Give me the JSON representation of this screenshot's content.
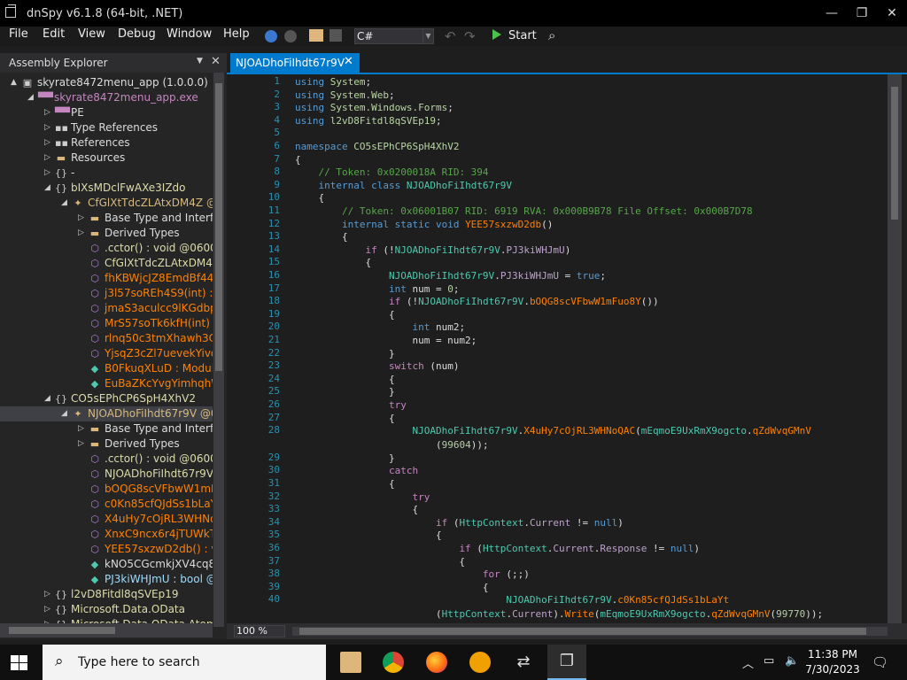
{
  "window": {
    "title": "dnSpy v6.1.8 (64-bit, .NET)"
  },
  "menu": [
    "File",
    "Edit",
    "View",
    "Debug",
    "Window",
    "Help"
  ],
  "toolbar": {
    "language": "C#",
    "start_label": "Start"
  },
  "assembly_explorer": {
    "title": "Assembly Explorer",
    "rows": [
      {
        "label": "skyrate8472menu_app (1.0.0.0)",
        "indent": 0,
        "toggle": "▲",
        "icon": "assembly-icon",
        "glyph": "▣",
        "color": "#dcdcdc",
        "icolor": "#ccc"
      },
      {
        "label": "skyrate8472menu_app.exe",
        "indent": 1,
        "toggle": "◢",
        "icon": "module-icon",
        "glyph": "▀▀",
        "color": "#c586c0",
        "icolor": "#c586c0"
      },
      {
        "label": "PE",
        "indent": 2,
        "toggle": "▷",
        "icon": "pe-icon",
        "glyph": "▀▀",
        "color": "#dcdcdc",
        "icolor": "#c586c0"
      },
      {
        "label": "Type References",
        "indent": 2,
        "toggle": "▷",
        "icon": "type-references-icon",
        "glyph": "▪▪",
        "color": "#dcdcdc",
        "icolor": "#ccc"
      },
      {
        "label": "References",
        "indent": 2,
        "toggle": "▷",
        "icon": "references-icon",
        "glyph": "▪▪",
        "color": "#dcdcdc",
        "icolor": "#ccc"
      },
      {
        "label": "Resources",
        "indent": 2,
        "toggle": "▷",
        "icon": "folder-icon",
        "glyph": "▬",
        "color": "#dcdcdc",
        "icolor": "#dcb67a"
      },
      {
        "label": "-",
        "indent": 2,
        "toggle": "▷",
        "icon": "namespace-icon",
        "glyph": "{}",
        "color": "#dcdcdc",
        "icolor": "#ccc"
      },
      {
        "label": "bIXsMDclFwAXe3IZdo",
        "indent": 2,
        "toggle": "◢",
        "icon": "namespace-icon",
        "glyph": "{}",
        "color": "#dcdcaa",
        "icolor": "#ccc"
      },
      {
        "label": "CfGlXtTdcZLAtxDM4Z @0",
        "indent": 3,
        "toggle": "◢",
        "icon": "class-icon",
        "glyph": "✦",
        "color": "#d7ba7d",
        "icolor": "#dcb67a"
      },
      {
        "label": "Base Type and Interfac",
        "indent": 4,
        "toggle": "▷",
        "icon": "folder-icon",
        "glyph": "▬",
        "color": "#dcdcdc",
        "icolor": "#dcb67a"
      },
      {
        "label": "Derived Types",
        "indent": 4,
        "toggle": "▷",
        "icon": "folder-icon",
        "glyph": "▬",
        "color": "#dcdcdc",
        "icolor": "#dcb67a"
      },
      {
        "label": ".cctor() : void @06001",
        "indent": 4,
        "toggle": "",
        "icon": "method-icon",
        "glyph": "⬡",
        "color": "#dcdcaa",
        "icolor": "#b180d7"
      },
      {
        "label": "CfGlXtTdcZLAtxDM4Z",
        "indent": 4,
        "toggle": "",
        "icon": "method-icon",
        "glyph": "⬡",
        "color": "#dcdcaa",
        "icolor": "#b180d7"
      },
      {
        "label": "fhKBWjcJZ8EmdBf44S",
        "indent": 4,
        "toggle": "",
        "icon": "method-icon",
        "glyph": "⬡",
        "color": "#ff8000",
        "icolor": "#b180d7"
      },
      {
        "label": "j3l57soREh4S9(int) : Ru",
        "indent": 4,
        "toggle": "",
        "icon": "method-icon",
        "glyph": "⬡",
        "color": "#ff8000",
        "icolor": "#b180d7"
      },
      {
        "label": "jmaS3aculcc9lKGdbpt",
        "indent": 4,
        "toggle": "",
        "icon": "method-icon",
        "glyph": "⬡",
        "color": "#ff8000",
        "icolor": "#b180d7"
      },
      {
        "label": "MrS57soTk6kfH(int) : I",
        "indent": 4,
        "toggle": "",
        "icon": "method-icon",
        "glyph": "⬡",
        "color": "#ff8000",
        "icolor": "#b180d7"
      },
      {
        "label": "rlnq50c3tmXhawh3Ch",
        "indent": 4,
        "toggle": "",
        "icon": "method-icon",
        "glyph": "⬡",
        "color": "#ff8000",
        "icolor": "#b180d7"
      },
      {
        "label": "YjsqZ3cZl7uevekYivo(",
        "indent": 4,
        "toggle": "",
        "icon": "method-icon",
        "glyph": "⬡",
        "color": "#ff8000",
        "icolor": "#b180d7"
      },
      {
        "label": "B0FkuqXLuD : Module",
        "indent": 4,
        "toggle": "",
        "icon": "field-icon",
        "glyph": "◆",
        "color": "#ff8000",
        "icolor": "#4ec9b0"
      },
      {
        "label": "EuBaZKcYvgYimhqhW",
        "indent": 4,
        "toggle": "",
        "icon": "field-icon",
        "glyph": "◆",
        "color": "#ff8000",
        "icolor": "#4ec9b0"
      },
      {
        "label": "CO5sEPhCP6SpH4XhV2",
        "indent": 2,
        "toggle": "◢",
        "icon": "namespace-icon",
        "glyph": "{}",
        "color": "#dcdcaa",
        "icolor": "#ccc"
      },
      {
        "label": "NJOADhoFiIhdt67r9V @02",
        "indent": 3,
        "toggle": "◢",
        "icon": "class-icon",
        "glyph": "✦",
        "color": "#d7ba7d",
        "icolor": "#dcb67a",
        "selected": true
      },
      {
        "label": "Base Type and Interfac",
        "indent": 4,
        "toggle": "▷",
        "icon": "folder-icon",
        "glyph": "▬",
        "color": "#dcdcdc",
        "icolor": "#dcb67a"
      },
      {
        "label": "Derived Types",
        "indent": 4,
        "toggle": "▷",
        "icon": "folder-icon",
        "glyph": "▬",
        "color": "#dcdcdc",
        "icolor": "#dcb67a"
      },
      {
        "label": ".cctor() : void @06001",
        "indent": 4,
        "toggle": "",
        "icon": "method-icon",
        "glyph": "⬡",
        "color": "#dcdcaa",
        "icolor": "#b180d7"
      },
      {
        "label": "NJOADhoFiIhdt67r9V(",
        "indent": 4,
        "toggle": "",
        "icon": "method-icon",
        "glyph": "⬡",
        "color": "#dcdcaa",
        "icolor": "#b180d7"
      },
      {
        "label": "bOQG8scVFbwW1mFu",
        "indent": 4,
        "toggle": "",
        "icon": "method-icon",
        "glyph": "⬡",
        "color": "#ff8000",
        "icolor": "#b180d7"
      },
      {
        "label": "c0Kn85cfQJdSs1bLaYt",
        "indent": 4,
        "toggle": "",
        "icon": "method-icon",
        "glyph": "⬡",
        "color": "#ff8000",
        "icolor": "#b180d7"
      },
      {
        "label": "X4uHy7cOjRL3WHNo",
        "indent": 4,
        "toggle": "",
        "icon": "method-icon",
        "glyph": "⬡",
        "color": "#ff8000",
        "icolor": "#b180d7"
      },
      {
        "label": "XnxC9ncx6r4jTUWkTZ",
        "indent": 4,
        "toggle": "",
        "icon": "method-icon",
        "glyph": "⬡",
        "color": "#ff8000",
        "icolor": "#b180d7"
      },
      {
        "label": "YEE57sxzwD2db() : voi",
        "indent": 4,
        "toggle": "",
        "icon": "method-icon",
        "glyph": "⬡",
        "color": "#ff8000",
        "icolor": "#b180d7"
      },
      {
        "label": "kNO5CGcmkjXV4cq83",
        "indent": 4,
        "toggle": "",
        "icon": "field-icon",
        "glyph": "◆",
        "color": "#dcdcdc",
        "icolor": "#4ec9b0"
      },
      {
        "label": "PJ3kiWHJmU : bool @0",
        "indent": 4,
        "toggle": "",
        "icon": "field-icon",
        "glyph": "◆",
        "color": "#9cdcfe",
        "icolor": "#4ec9b0"
      },
      {
        "label": "l2vD8Fitdl8qSVEp19",
        "indent": 2,
        "toggle": "▷",
        "icon": "namespace-icon",
        "glyph": "{}",
        "color": "#dcdcaa",
        "icolor": "#ccc"
      },
      {
        "label": "Microsoft.Data.OData",
        "indent": 2,
        "toggle": "▷",
        "icon": "namespace-icon",
        "glyph": "{}",
        "color": "#dcdcaa",
        "icolor": "#ccc"
      },
      {
        "label": "Microsoft.Data.OData.Atom",
        "indent": 2,
        "toggle": "▷",
        "icon": "namespace-icon",
        "glyph": "{}",
        "color": "#dcdcaa",
        "icolor": "#ccc"
      }
    ]
  },
  "editor": {
    "tab": "NJOADhoFiIhdt67r9V",
    "zoom": "100 %",
    "lines": [
      {
        "n": "1",
        "html": "<span class=\"kw\">using</span> <span class=\"ty2\">System</span>;"
      },
      {
        "n": "2",
        "html": "<span class=\"kw\">using</span> <span class=\"ty2\">System.Web</span>;"
      },
      {
        "n": "3",
        "html": "<span class=\"kw\">using</span> <span class=\"ty2\">System.Windows.Forms</span>;"
      },
      {
        "n": "4",
        "html": "<span class=\"kw\">using</span> <span class=\"ty2\">l2vD8Fitdl8qSVEp19</span>;"
      },
      {
        "n": "5",
        "html": ""
      },
      {
        "n": "6",
        "html": "<span class=\"kw\">namespace</span> <span class=\"ty2\">CO5sEPhCP6SpH4XhV2</span>"
      },
      {
        "n": "7",
        "html": "{"
      },
      {
        "n": "8",
        "html": "    <span class=\"cm\">// Token: 0x0200018A RID: 394</span>"
      },
      {
        "n": "9",
        "html": "    <span class=\"kw\">internal class</span> <span class=\"ty\">NJOADhoFiIhdt67r9V</span>"
      },
      {
        "n": "10",
        "html": "    {"
      },
      {
        "n": "11",
        "html": "        <span class=\"cm\">// Token: 0x06001B07 RID: 6919 RVA: 0x000B9B78 File Offset: 0x000B7D78</span>"
      },
      {
        "n": "12",
        "html": "        <span class=\"kw\">internal static void</span> <span class=\"mn\">YEE57sxzwD2db</span>()"
      },
      {
        "n": "13",
        "html": "        {"
      },
      {
        "n": "14",
        "html": "            <span class=\"fl\">if</span> (!<span class=\"ty\">NJOADhoFiIhdt67r9V</span>.<span class=\"pr\">PJ3kiWHJmU</span>)"
      },
      {
        "n": "15",
        "html": "            {"
      },
      {
        "n": "16",
        "html": "                <span class=\"ty\">NJOADhoFiIhdt67r9V</span>.<span class=\"pr\">PJ3kiWHJmU</span> = <span class=\"kw\">true</span>;"
      },
      {
        "n": "17",
        "html": "                <span class=\"kw\">int</span> num = <span class=\"nm\">0</span>;"
      },
      {
        "n": "18",
        "html": "                <span class=\"fl\">if</span> (!<span class=\"ty\">NJOADhoFiIhdt67r9V</span>.<span class=\"mn\">bOQG8scVFbwW1mFuo8Y</span>())"
      },
      {
        "n": "19",
        "html": "                {"
      },
      {
        "n": "20",
        "html": "                    <span class=\"kw\">int</span> num2;"
      },
      {
        "n": "21",
        "html": "                    num = num2;"
      },
      {
        "n": "22",
        "html": "                }"
      },
      {
        "n": "23",
        "html": "                <span class=\"fl\">switch</span> (num)"
      },
      {
        "n": "24",
        "html": "                {"
      },
      {
        "n": "25",
        "html": "                }"
      },
      {
        "n": "26",
        "html": "                <span class=\"fl\">try</span>"
      },
      {
        "n": "27",
        "html": "                {"
      },
      {
        "n": "28",
        "html": "                    <span class=\"ty\">NJOADhoFiIhdt67r9V</span>.<span class=\"mn\">X4uHy7cOjRL3WHNoQAC</span>(<span class=\"ty\">mEqmoE9UxRmX9ogcto</span>.<span class=\"mn\">qZdWvqGMnV</span>\n                        (<span class=\"nm\">99604</span>));"
      },
      {
        "n": "29",
        "html": "                }"
      },
      {
        "n": "30",
        "html": "                <span class=\"fl\">catch</span>"
      },
      {
        "n": "31",
        "html": "                {"
      },
      {
        "n": "32",
        "html": "                    <span class=\"fl\">try</span>"
      },
      {
        "n": "33",
        "html": "                    {"
      },
      {
        "n": "34",
        "html": "                        <span class=\"fl\">if</span> (<span class=\"ty\">HttpContext</span>.<span class=\"pr\">Current</span> != <span class=\"kw\">null</span>)"
      },
      {
        "n": "35",
        "html": "                        {"
      },
      {
        "n": "36",
        "html": "                            <span class=\"fl\">if</span> (<span class=\"ty\">HttpContext</span>.<span class=\"pr\">Current</span>.<span class=\"pr\">Response</span> != <span class=\"kw\">null</span>)"
      },
      {
        "n": "37",
        "html": "                            {"
      },
      {
        "n": "38",
        "html": "                                <span class=\"fl\">for</span> (;;)"
      },
      {
        "n": "39",
        "html": "                                {"
      },
      {
        "n": "40",
        "html": "                                    <span class=\"ty\">NJOADhoFiIhdt67r9V</span>.<span class=\"mn\">c0Kn85cfQJdSs1bLaYt</span>\n                        (<span class=\"ty\">HttpContext</span>.<span class=\"pr\">Current</span>).<span class=\"mn\">Write</span>(<span class=\"ty\">mEqmoE9UxRmX9ogcto</span>.<span class=\"mn\">qZdWvqGMnV</span>(<span class=\"nm\">99770</span>));"
      }
    ]
  },
  "taskbar": {
    "search_placeholder": "Type here to search",
    "time": "11:38 PM",
    "date": "7/30/2023"
  }
}
